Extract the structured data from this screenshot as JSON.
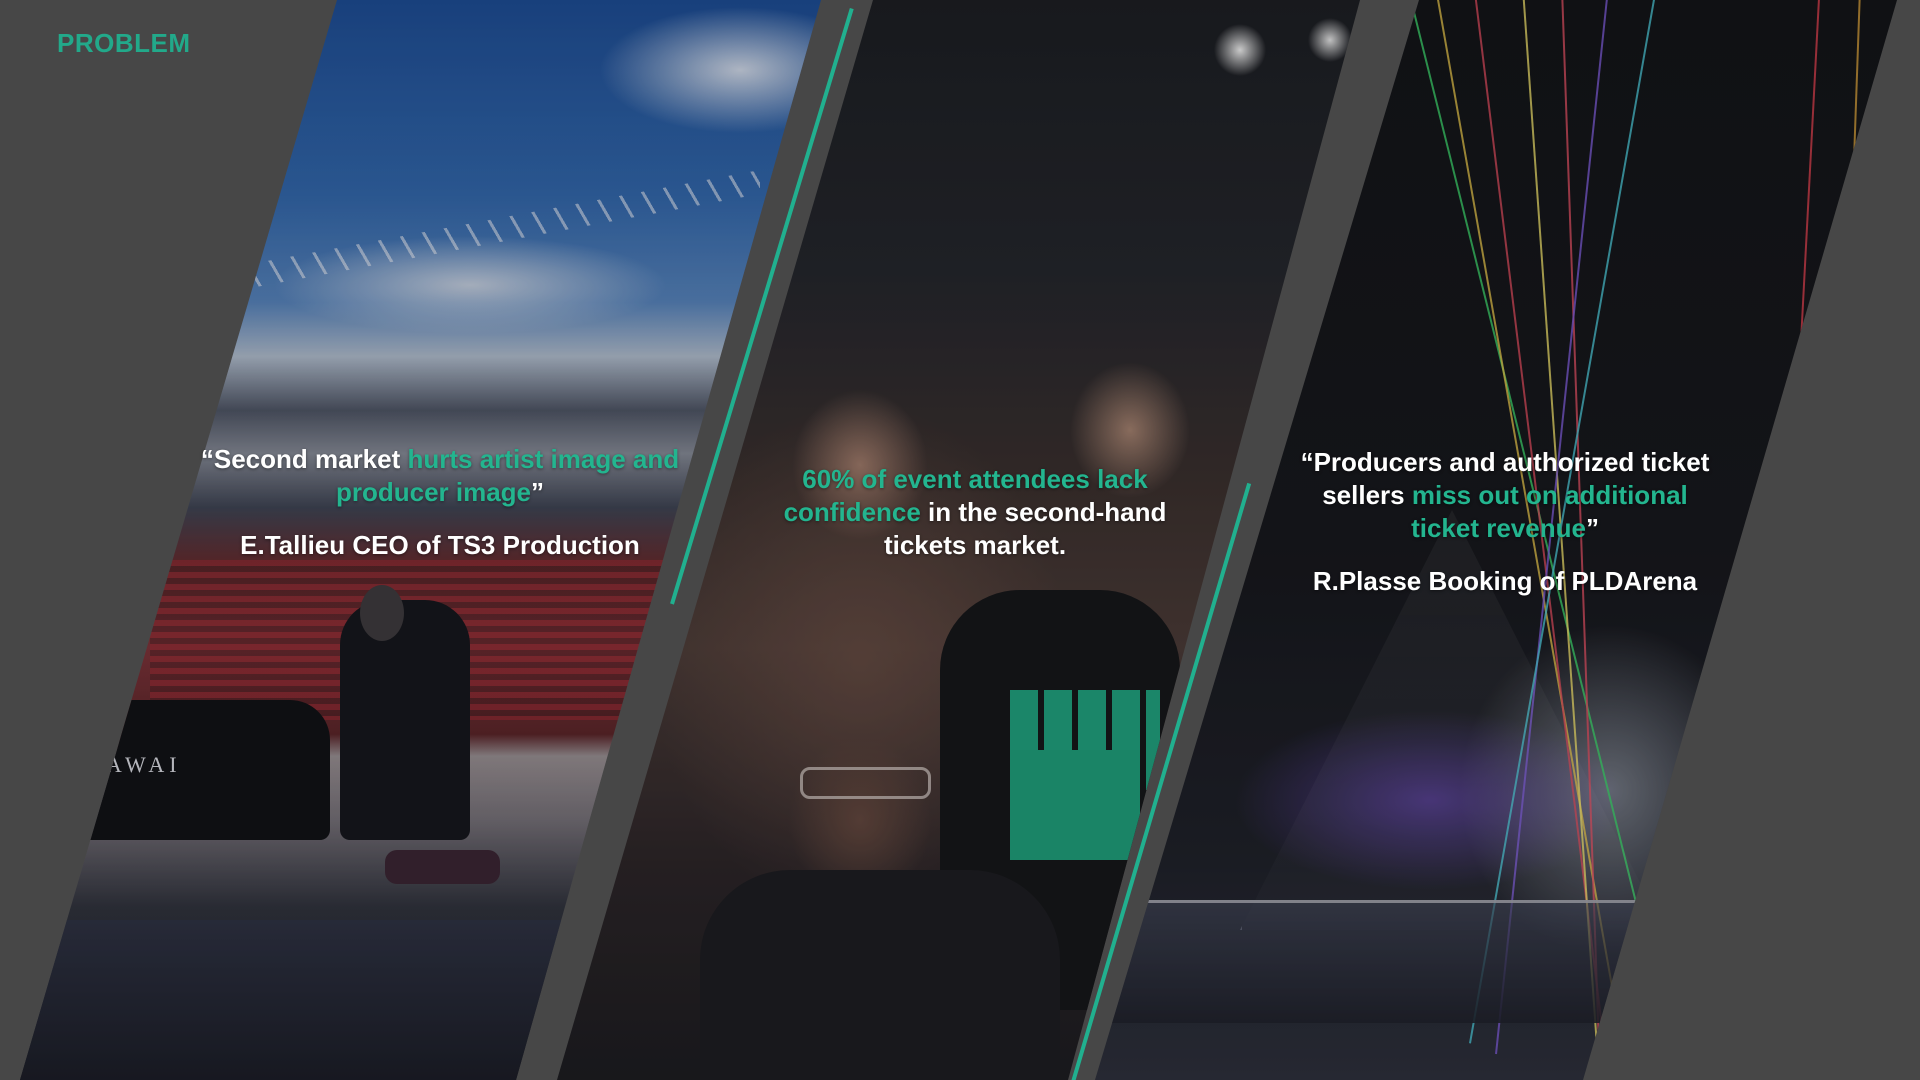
{
  "slide": {
    "label": "PROBLEM",
    "accent_color": "#23b58f",
    "background_color": "#474747"
  },
  "panels": [
    {
      "name": "stadium-pianist",
      "image_description_icon": "stadium-photo",
      "brand_text": "KAWAI",
      "quote": {
        "open": "“Second market ",
        "highlight": "hurts artist image and producer image",
        "close": "”",
        "attribution": "E.Tallieu CEO of TS3 Production"
      }
    },
    {
      "name": "crowd",
      "image_description_icon": "crowd-photo",
      "quote": {
        "highlight": "60% of event attendees  lack confidence",
        "rest": " in the second-hand tickets market."
      }
    },
    {
      "name": "laser-show",
      "image_description_icon": "laser-show-photo",
      "quote": {
        "open": "“Producers and authorized ticket sellers ",
        "highlight": "miss out on additional ticket revenue",
        "close": "”",
        "attribution": "R.Plasse Booking of PLDArena"
      }
    }
  ]
}
